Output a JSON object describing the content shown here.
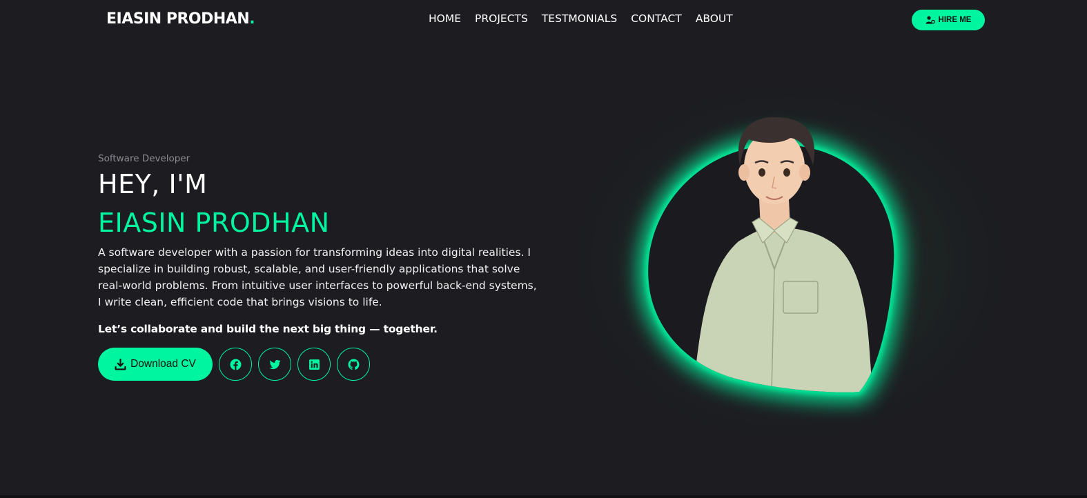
{
  "nav": {
    "logo_text": "EIASIN PRODHAN",
    "logo_dot": ".",
    "links": [
      "HOME",
      "PROJECTS",
      "TESTMONIALS",
      "CONTACT",
      "ABOUT"
    ],
    "hire_label": "HIRE ME"
  },
  "hero": {
    "role": "Software Developer",
    "greeting": "HEY, I'M",
    "name": "EIASIN PRODHAN",
    "bio": "A software developer with a passion for transforming ideas into digital realities. I specialize in building robust, scalable, and user-friendly applications that solve real-world problems. From intuitive user interfaces to powerful back-end systems, I write clean, efficient code that brings visions to life.",
    "tagline": "Let’s collaborate and build the next big thing — together.",
    "cv_label": "Download CV"
  },
  "social_icons": [
    "facebook-icon",
    "twitter-icon",
    "linkedin-icon",
    "github-icon"
  ],
  "colors": {
    "accent": "#00f5a0",
    "background": "#1c1c21",
    "text": "#ffffff",
    "muted": "#8a8a90"
  }
}
